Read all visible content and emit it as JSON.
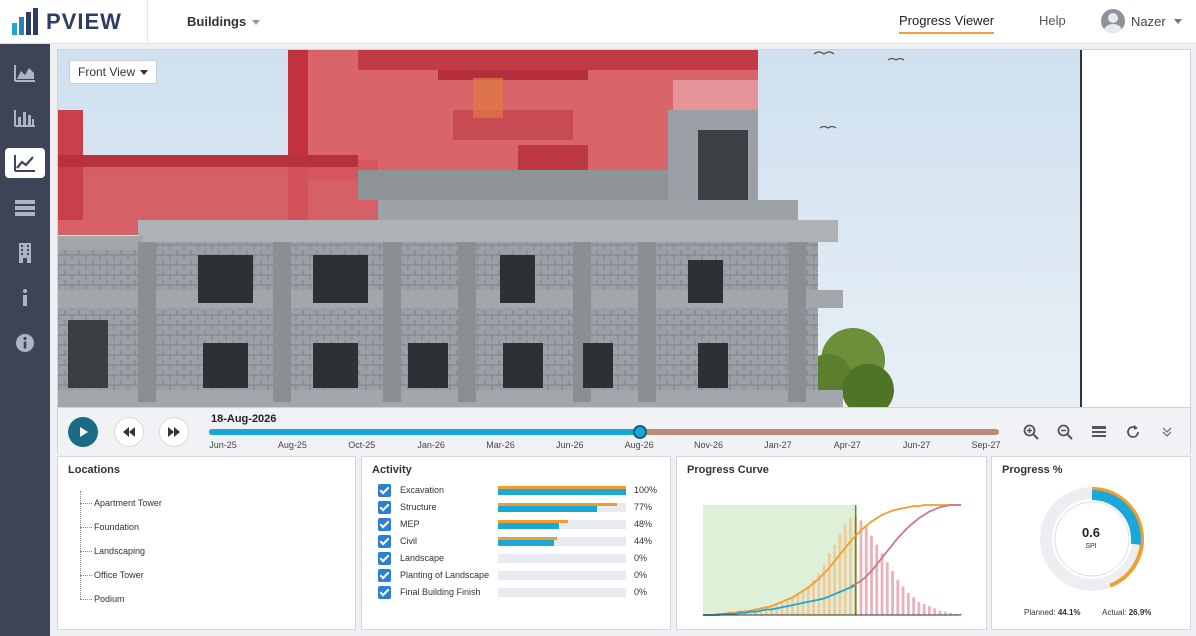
{
  "brand": {
    "name": "PVIEW"
  },
  "header": {
    "building_selector": "Buildings",
    "nav_active": "Progress Viewer",
    "nav_help": "Help",
    "user_name": "Nazer"
  },
  "sidebar": {
    "items": [
      {
        "icon": "area-chart-icon"
      },
      {
        "icon": "bar-chart-icon"
      },
      {
        "icon": "line-chart-icon",
        "active": true
      },
      {
        "icon": "list-icon"
      },
      {
        "icon": "building-icon"
      },
      {
        "icon": "info-small-icon"
      },
      {
        "icon": "info-circle-icon"
      }
    ]
  },
  "viewer": {
    "view_mode": "Front View"
  },
  "timeline": {
    "current_date": "18-Aug-2026",
    "position_fraction": 0.545,
    "ticks": [
      "Jun-25",
      "Aug-25",
      "Oct-25",
      "Jan-26",
      "Mar-26",
      "Jun-26",
      "Aug-26",
      "Nov-26",
      "Jan-27",
      "Apr-27",
      "Jun-27",
      "Sep-27"
    ],
    "colors": {
      "elapsed": "#17a7d8",
      "remaining": "#b98c73"
    }
  },
  "locations": {
    "title": "Locations",
    "items": [
      "Apartment Tower",
      "Foundation",
      "Landscaping",
      "Office Tower",
      "Podium"
    ]
  },
  "activity": {
    "title": "Activity",
    "items": [
      {
        "name": "Excavation",
        "planned": 100,
        "actual": 100,
        "label": "100%"
      },
      {
        "name": "Structure",
        "planned": 93,
        "actual": 77,
        "label": "77%"
      },
      {
        "name": "MEP",
        "planned": 55,
        "actual": 48,
        "label": "48%"
      },
      {
        "name": "Civil",
        "planned": 46,
        "actual": 44,
        "label": "44%"
      },
      {
        "name": "Landscape",
        "planned": 0,
        "actual": 0,
        "label": "0%"
      },
      {
        "name": "Planting of Landscape",
        "planned": 0,
        "actual": 0,
        "label": "0%"
      },
      {
        "name": "Final Building Finish",
        "planned": 0,
        "actual": 0,
        "label": "0%"
      }
    ],
    "colors": {
      "planned": "#f0a02a",
      "actual": "#1ba8d8"
    }
  },
  "progress_curve": {
    "title": "Progress Curve"
  },
  "progress_pct": {
    "title": "Progress %",
    "spi_value": "0.6",
    "spi_label": "SPI",
    "planned_label": "Planned:",
    "planned_value": "44.1%",
    "actual_label": "Actual:",
    "actual_value": "26.9%",
    "planned_fraction": 0.441,
    "actual_fraction": 0.269
  },
  "chart_data": {
    "type": "bar",
    "x": [
      1,
      2,
      3,
      4,
      5,
      6,
      7,
      8,
      9,
      10,
      11,
      12,
      13,
      14,
      15,
      16,
      17,
      18,
      19,
      20,
      21,
      22,
      23,
      24,
      25,
      26,
      27,
      28,
      29,
      30,
      31,
      32,
      33,
      34,
      35,
      36,
      37,
      38,
      39,
      40,
      41,
      42,
      43,
      44,
      45,
      46,
      47,
      48,
      49,
      50
    ],
    "series": [
      {
        "kind": "bar",
        "values": [
          0,
          1,
          1,
          2,
          2,
          3,
          3,
          4,
          5,
          5,
          6,
          7,
          8,
          9,
          10,
          12,
          14,
          16,
          18,
          22,
          26,
          32,
          38,
          46,
          56,
          64,
          74,
          82,
          88,
          90,
          86,
          80,
          72,
          64,
          56,
          48,
          40,
          32,
          26,
          20,
          16,
          12,
          10,
          8,
          6,
          4,
          3,
          2,
          1,
          1
        ]
      },
      {
        "kind": "line",
        "color": "#f0a02a",
        "values": [
          0,
          0,
          0,
          1,
          1,
          2,
          2,
          3,
          3,
          4,
          5,
          6,
          7,
          8,
          10,
          12,
          14,
          16,
          19,
          22,
          25,
          29,
          33,
          38,
          43,
          49,
          55,
          61,
          67,
          72,
          77,
          81,
          85,
          88,
          91,
          93,
          95,
          96,
          97,
          98,
          99,
          99,
          100,
          100,
          100,
          100,
          100,
          100,
          100,
          100
        ]
      },
      {
        "kind": "line",
        "color": "#1ba8d8",
        "values": [
          0,
          0,
          0,
          0,
          1,
          1,
          1,
          2,
          2,
          3,
          3,
          4,
          5,
          5,
          6,
          7,
          8,
          9,
          10,
          11,
          12,
          13,
          14,
          15,
          17,
          19,
          21,
          23,
          25,
          27
        ]
      },
      {
        "kind": "line",
        "color": "#c7798a",
        "values": [
          0,
          0,
          0,
          0,
          0,
          0,
          0,
          0,
          0,
          0,
          0,
          0,
          0,
          0,
          0,
          0,
          0,
          0,
          0,
          0,
          0,
          0,
          0,
          0,
          0,
          0,
          0,
          0,
          26,
          28,
          31,
          35,
          40,
          46,
          52,
          58,
          64,
          70,
          75,
          80,
          84,
          88,
          91,
          94,
          96,
          98,
          99,
          100,
          100,
          100
        ]
      }
    ],
    "ylim": [
      0,
      100
    ],
    "grid": false,
    "legend": "none"
  }
}
